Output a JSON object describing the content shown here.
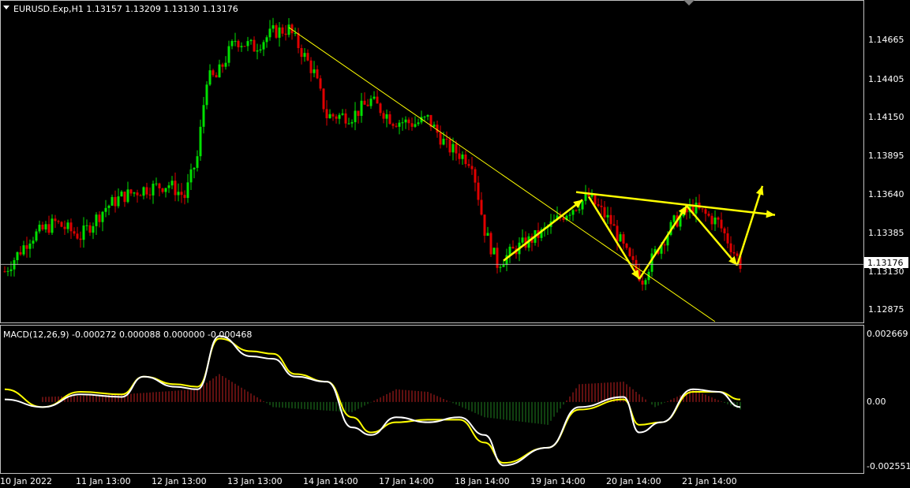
{
  "window": {
    "symbol_header": "EURUSD.Exp,H1  1.13157 1.13209 1.13130 1.13176",
    "macd_header": "MACD(12,26,9) -0.000272 0.000088 0.000000 -0.000468"
  },
  "price_scale": {
    "labels": [
      "1.14665",
      "1.14405",
      "1.14150",
      "1.13895",
      "1.13640",
      "1.13385",
      "1.13130",
      "1.12875"
    ],
    "current_price": "1.13176"
  },
  "macd_scale": {
    "labels": [
      "0.002669",
      "0.00",
      "-0.002551"
    ]
  },
  "time_axis": {
    "labels": [
      "10 Jan 2022",
      "11 Jan 13:00",
      "12 Jan 13:00",
      "13 Jan 13:00",
      "14 Jan 14:00",
      "17 Jan 14:00",
      "18 Jan 14:00",
      "19 Jan 14:00",
      "20 Jan 14:00",
      "21 Jan 14:00"
    ]
  },
  "colors": {
    "background": "#000000",
    "bull_candle": "#00e000",
    "bear_candle": "#e00000",
    "trendline": "#ffff00",
    "arrow": "#ffff00",
    "macd_main": "#ffffff",
    "macd_signal": "#ffff00",
    "hist_pos": "#c02020",
    "hist_neg": "#208020",
    "grid_text": "#ffffff",
    "current_price_line": "#c0c0c0"
  },
  "icons": [
    "dropdown-triangle-icon"
  ],
  "chart_data": {
    "type": "candlestick",
    "close_path": [
      [
        "10 Jan 2022 00:00",
        1.1313
      ],
      [
        "10 Jan 2022 08:00",
        1.1335
      ],
      [
        "10 Jan 2022 16:00",
        1.1345
      ],
      [
        "11 Jan 2022 00:00",
        1.1336
      ],
      [
        "11 Jan 2022 08:00",
        1.1355
      ],
      [
        "11 Jan 2022 13:00",
        1.1362
      ],
      [
        "11 Jan 2022 20:00",
        1.1367
      ],
      [
        "12 Jan 2022 04:00",
        1.137
      ],
      [
        "12 Jan 2022 09:00",
        1.1362
      ],
      [
        "12 Jan 2022 13:00",
        1.1388
      ],
      [
        "12 Jan 2022 16:00",
        1.144
      ],
      [
        "12 Jan 2022 19:00",
        1.144
      ],
      [
        "13 Jan 2022 01:00",
        1.1465
      ],
      [
        "13 Jan 2022 07:00",
        1.146
      ],
      [
        "13 Jan 2022 13:00",
        1.147
      ],
      [
        "13 Jan 2022 18:00",
        1.1472
      ],
      [
        "14 Jan 2022 02:00",
        1.1443
      ],
      [
        "14 Jan 2022 06:00",
        1.1415
      ],
      [
        "14 Jan 2022 14:00",
        1.1415
      ],
      [
        "14 Jan 2022 20:00",
        1.1425
      ],
      [
        "17 Jan 2022 03:00",
        1.1412
      ],
      [
        "17 Jan 2022 10:00",
        1.141
      ],
      [
        "17 Jan 2022 14:00",
        1.1413
      ],
      [
        "17 Jan 2022 20:00",
        1.1395
      ],
      [
        "18 Jan 2022 04:00",
        1.1385
      ],
      [
        "18 Jan 2022 08:00",
        1.134
      ],
      [
        "18 Jan 2022 12:00",
        1.1318
      ],
      [
        "18 Jan 2022 18:00",
        1.1328
      ],
      [
        "19 Jan 2022 02:00",
        1.1338
      ],
      [
        "19 Jan 2022 10:00",
        1.1352
      ],
      [
        "19 Jan 2022 17:00",
        1.1362
      ],
      [
        "20 Jan 2022 00:00",
        1.1345
      ],
      [
        "20 Jan 2022 06:00",
        1.132
      ],
      [
        "20 Jan 2022 10:00",
        1.1308
      ],
      [
        "20 Jan 2022 14:00",
        1.1325
      ],
      [
        "20 Jan 2022 20:00",
        1.1345
      ],
      [
        "21 Jan 2022 02:00",
        1.1355
      ],
      [
        "21 Jan 2022 10:00",
        1.1345
      ],
      [
        "21 Jan 2022 17:00",
        1.1318
      ]
    ],
    "price_range": [
      1.128,
      1.149
    ],
    "current_price": 1.13176,
    "trendlines": [
      {
        "name": "",
        "from": [
          "13 Jan 2022 18:00",
          1.1473
        ],
        "to": [
          "21 Jan 2022 09:00",
          1.128
        ]
      },
      {
        "name": "",
        "from": [
          "19 Jan 2022 13:00",
          1.1365
        ],
        "to": [
          "22 Jan 2022 04:00",
          1.135
        ]
      }
    ],
    "arrows": [
      {
        "from": [
          "18 Jan 2022 14:00",
          1.132
        ],
        "to": [
          "19 Jan 2022 15:00",
          1.136
        ]
      },
      {
        "from": [
          "19 Jan 2022 17:00",
          1.1362
        ],
        "to": [
          "20 Jan 2022 09:00",
          1.1308
        ]
      },
      {
        "from": [
          "20 Jan 2022 09:00",
          1.1308
        ],
        "to": [
          "21 Jan 2022 00:00",
          1.1356
        ]
      },
      {
        "from": [
          "21 Jan 2022 00:00",
          1.1356
        ],
        "to": [
          "21 Jan 2022 16:00",
          1.1317
        ]
      },
      {
        "from": [
          "21 Jan 2022 16:00",
          1.1317
        ],
        "to": [
          "22 Jan 2022 00:00",
          1.1369
        ]
      },
      {
        "from": [
          "19 Jan 2022 13:00",
          1.1365
        ],
        "to": [
          "22 Jan 2022 04:00",
          1.135
        ]
      }
    ],
    "macd": {
      "range": [
        -0.002551,
        0.002669
      ],
      "main": [
        [
          "10 Jan 2022 00:00",
          0.0001
        ],
        [
          "10 Jan 2022 12:00",
          -0.0002
        ],
        [
          "11 Jan 2022 00:00",
          0.0003
        ],
        [
          "11 Jan 2022 13:00",
          0.0002
        ],
        [
          "11 Jan 2022 20:00",
          0.001
        ],
        [
          "12 Jan 2022 06:00",
          0.0006
        ],
        [
          "12 Jan 2022 13:00",
          0.0005
        ],
        [
          "12 Jan 2022 20:00",
          0.0026
        ],
        [
          "13 Jan 2022 06:00",
          0.0018
        ],
        [
          "13 Jan 2022 13:00",
          0.0017
        ],
        [
          "13 Jan 2022 20:00",
          0.001
        ],
        [
          "14 Jan 2022 06:00",
          0.0008
        ],
        [
          "14 Jan 2022 14:00",
          -0.001
        ],
        [
          "14 Jan 2022 20:00",
          -0.0013
        ],
        [
          "17 Jan 2022 04:00",
          -0.0006
        ],
        [
          "17 Jan 2022 14:00",
          -0.0008
        ],
        [
          "18 Jan 2022 00:00",
          -0.0006
        ],
        [
          "18 Jan 2022 08:00",
          -0.0013
        ],
        [
          "18 Jan 2022 14:00",
          -0.0025
        ],
        [
          "19 Jan 2022 04:00",
          -0.0018
        ],
        [
          "19 Jan 2022 14:00",
          -0.0002
        ],
        [
          "20 Jan 2022 04:00",
          0.0002
        ],
        [
          "20 Jan 2022 09:00",
          -0.0012
        ],
        [
          "20 Jan 2022 16:00",
          -0.0008
        ],
        [
          "21 Jan 2022 02:00",
          0.0005
        ],
        [
          "21 Jan 2022 10:00",
          0.0004
        ],
        [
          "21 Jan 2022 17:00",
          -0.0002
        ]
      ],
      "signal": [
        [
          "10 Jan 2022 00:00",
          0.0005
        ],
        [
          "10 Jan 2022 12:00",
          -0.0002
        ],
        [
          "11 Jan 2022 00:00",
          0.0004
        ],
        [
          "11 Jan 2022 13:00",
          0.0003
        ],
        [
          "11 Jan 2022 20:00",
          0.001
        ],
        [
          "12 Jan 2022 06:00",
          0.0007
        ],
        [
          "12 Jan 2022 13:00",
          0.0006
        ],
        [
          "12 Jan 2022 20:00",
          0.0025
        ],
        [
          "13 Jan 2022 06:00",
          0.002
        ],
        [
          "13 Jan 2022 13:00",
          0.0019
        ],
        [
          "13 Jan 2022 20:00",
          0.0011
        ],
        [
          "14 Jan 2022 06:00",
          0.0008
        ],
        [
          "14 Jan 2022 14:00",
          -0.0006
        ],
        [
          "14 Jan 2022 20:00",
          -0.0012
        ],
        [
          "17 Jan 2022 04:00",
          -0.0008
        ],
        [
          "17 Jan 2022 14:00",
          -0.0007
        ],
        [
          "18 Jan 2022 00:00",
          -0.0007
        ],
        [
          "18 Jan 2022 08:00",
          -0.0016
        ],
        [
          "18 Jan 2022 14:00",
          -0.0024
        ],
        [
          "19 Jan 2022 04:00",
          -0.0018
        ],
        [
          "19 Jan 2022 14:00",
          -0.0003
        ],
        [
          "20 Jan 2022 04:00",
          0.0001
        ],
        [
          "20 Jan 2022 09:00",
          -0.0009
        ],
        [
          "20 Jan 2022 16:00",
          -0.0008
        ],
        [
          "21 Jan 2022 02:00",
          0.0004
        ],
        [
          "21 Jan 2022 10:00",
          0.0004
        ],
        [
          "21 Jan 2022 17:00",
          0.0001
        ]
      ],
      "histogram": [
        [
          "10 Jan 2022 12:00",
          0.0002
        ],
        [
          "11 Jan 2022 13:00",
          0.0003
        ],
        [
          "12 Jan 2022 13:00",
          0.0005
        ],
        [
          "12 Jan 2022 20:00",
          0.0011
        ],
        [
          "13 Jan 2022 13:00",
          -0.0002
        ],
        [
          "14 Jan 2022 14:00",
          -0.0004
        ],
        [
          "17 Jan 2022 04:00",
          0.0005
        ],
        [
          "17 Jan 2022 14:00",
          0.0004
        ],
        [
          "18 Jan 2022 08:00",
          -0.0006
        ],
        [
          "19 Jan 2022 04:00",
          -0.0009
        ],
        [
          "19 Jan 2022 14:00",
          0.0007
        ],
        [
          "20 Jan 2022 04:00",
          0.0008
        ],
        [
          "20 Jan 2022 14:00",
          -0.0002
        ],
        [
          "21 Jan 2022 02:00",
          0.0005
        ],
        [
          "21 Jan 2022 17:00",
          -0.0003
        ]
      ]
    }
  }
}
